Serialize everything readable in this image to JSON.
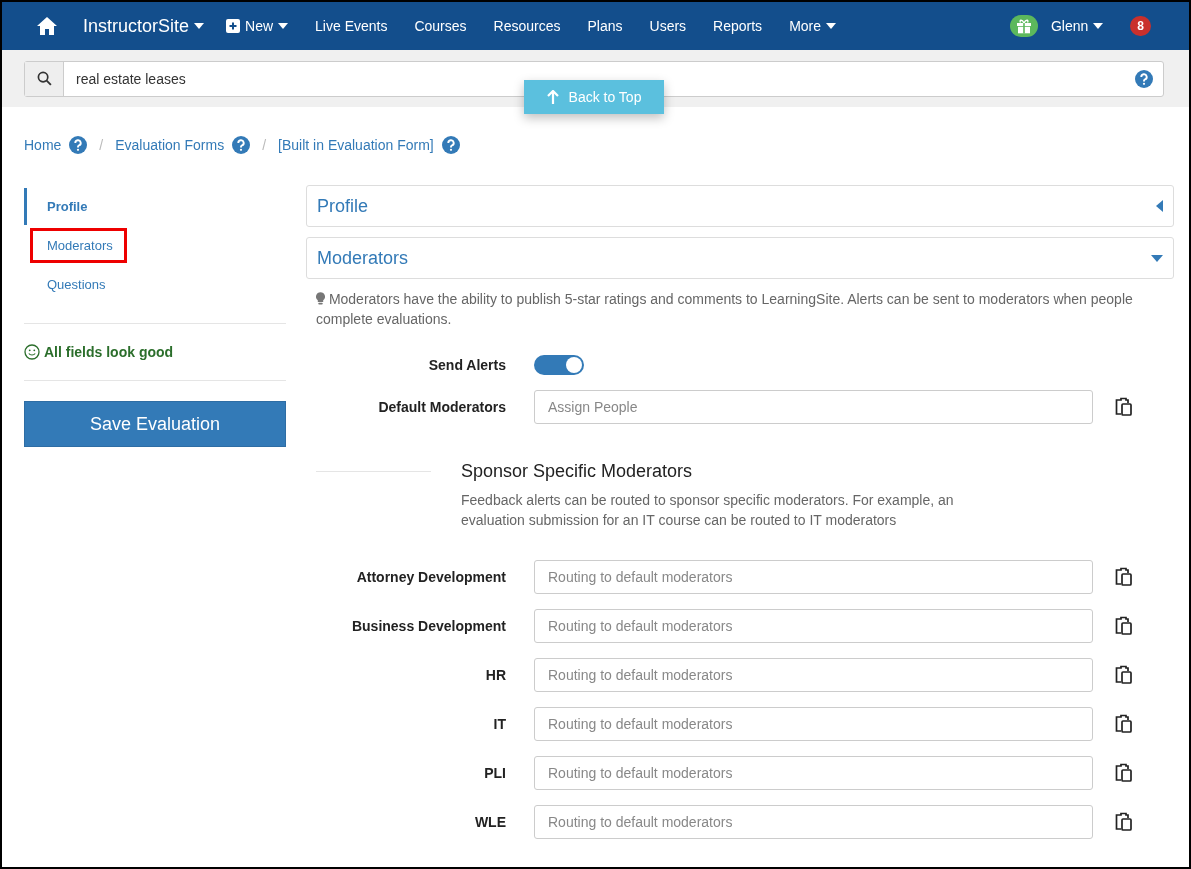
{
  "navbar": {
    "brand": "InstructorSite",
    "new_label": "New",
    "items": [
      "Live Events",
      "Courses",
      "Resources",
      "Plans",
      "Users",
      "Reports"
    ],
    "more_label": "More",
    "user": "Glenn",
    "notification_count": "8"
  },
  "search": {
    "value": "real estate leases"
  },
  "back_to_top": "Back to Top",
  "breadcrumbs": [
    "Home",
    "Evaluation Forms",
    "[Built in Evaluation Form]"
  ],
  "breadcrumb_separator": "/",
  "sidebar": {
    "items": [
      {
        "label": "Profile",
        "selected": true,
        "highlighted": false
      },
      {
        "label": "Moderators",
        "selected": false,
        "highlighted": true
      },
      {
        "label": "Questions",
        "selected": false,
        "highlighted": false
      }
    ],
    "status": "All fields look good",
    "save_button": "Save Evaluation"
  },
  "panels": [
    {
      "title": "Profile",
      "expanded": false
    },
    {
      "title": "Moderators",
      "expanded": true
    }
  ],
  "hint": "Moderators have the ability to publish 5-star ratings and comments to LearningSite. Alerts can be sent to moderators when people complete evaluations.",
  "send_alerts": {
    "label": "Send Alerts",
    "on": true
  },
  "default_moderators": {
    "label": "Default Moderators",
    "placeholder": "Assign People"
  },
  "sponsor_section": {
    "title": "Sponsor Specific Moderators",
    "description": "Feedback alerts can be routed to sponsor specific moderators. For example, an evaluation submission for an IT course can be routed to IT moderators"
  },
  "sponsors": [
    {
      "label": "Attorney Development",
      "placeholder": "Routing to default moderators"
    },
    {
      "label": "Business Development",
      "placeholder": "Routing to default moderators"
    },
    {
      "label": "HR",
      "placeholder": "Routing to default moderators"
    },
    {
      "label": "IT",
      "placeholder": "Routing to default moderators"
    },
    {
      "label": "PLI",
      "placeholder": "Routing to default moderators"
    },
    {
      "label": "WLE",
      "placeholder": "Routing to default moderators"
    }
  ]
}
